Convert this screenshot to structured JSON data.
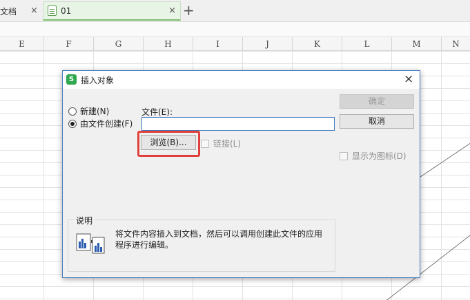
{
  "tabs": [
    {
      "label": "文档",
      "close": "×"
    },
    {
      "label": "01",
      "close": "×"
    }
  ],
  "new_tab": "+",
  "columns": [
    "E",
    "F",
    "G",
    "H",
    "I",
    "J",
    "K",
    "L",
    "M",
    "N"
  ],
  "dialog": {
    "logo": "S",
    "title": "插入对象",
    "close": "×",
    "radio_new": "新建(N)",
    "radio_from_file": "由文件创建(F)",
    "selected_radio": "from_file",
    "file_label": "文件(E):",
    "file_value": "",
    "browse_label": "浏览(B)...",
    "link_label": "链接(L)",
    "show_icon_label": "显示为图标(D)",
    "ok_label": "确定",
    "cancel_label": "取消",
    "desc_title": "说明",
    "desc_text": "将文件内容插入到文档，然后可以调用创建此文件的应用程序进行编辑。"
  },
  "colors": {
    "accent_green": "#2fa84f",
    "highlight_red": "#e0403c",
    "input_border": "#3c78c0"
  }
}
